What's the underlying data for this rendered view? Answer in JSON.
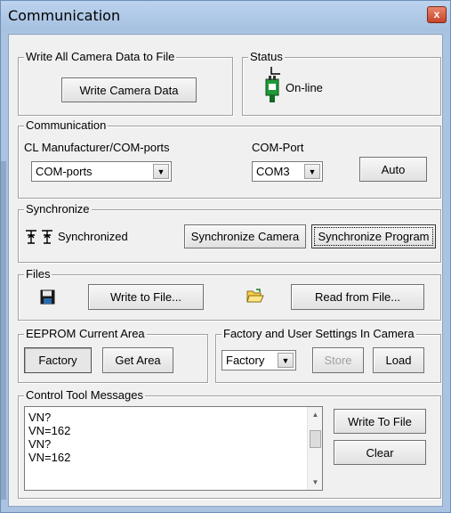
{
  "window": {
    "title": "Communication",
    "close_symbol": "x"
  },
  "write_all": {
    "legend": "Write All Camera Data to File",
    "button": "Write Camera Data"
  },
  "status": {
    "legend": "Status",
    "text": "On-line",
    "icon": "plug-connected-icon"
  },
  "communication": {
    "legend": "Communication",
    "cl_label": "CL Manufacturer/COM-ports",
    "cl_value": "COM-ports",
    "port_label": "COM-Port",
    "port_value": "COM3",
    "auto_button": "Auto"
  },
  "synchronize": {
    "legend": "Synchronize",
    "status_text": "Synchronized",
    "camera_button": "Synchronize Camera",
    "program_button": "Synchronize Program"
  },
  "files": {
    "legend": "Files",
    "write_button": "Write to File...",
    "read_button": "Read from File..."
  },
  "eeprom": {
    "legend": "EEPROM Current Area",
    "factory_button": "Factory",
    "get_area_button": "Get Area"
  },
  "factory_user": {
    "legend": "Factory and User Settings In Camera",
    "select_value": "Factory",
    "store_button": "Store",
    "load_button": "Load"
  },
  "messages": {
    "legend": "Control Tool Messages",
    "lines": [
      "VN?",
      "VN=162",
      "VN?",
      "VN=162"
    ],
    "write_button": "Write To File",
    "clear_button": "Clear"
  },
  "colors": {
    "titlebar": "#a9c3e1",
    "close": "#c6442a",
    "face": "#f0f0f0"
  }
}
